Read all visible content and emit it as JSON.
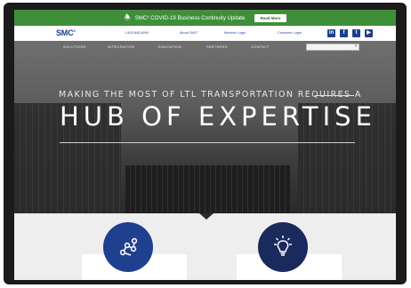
{
  "banner": {
    "text": "SMC³ COVID-19 Business Continuity Update",
    "button_label": "Read More",
    "icon": "bell-icon"
  },
  "topbar": {
    "logo": "SMC",
    "logo_sup": "3",
    "phone": "1-800-845-8090",
    "about": "About SMC³",
    "member_login": "Member Login",
    "customer_login": "Customer Login",
    "social": [
      {
        "icon": "linkedin-icon",
        "glyph": "in"
      },
      {
        "icon": "facebook-icon",
        "glyph": "f"
      },
      {
        "icon": "twitter-icon",
        "glyph": "t"
      },
      {
        "icon": "youtube-icon",
        "glyph": "▶"
      }
    ]
  },
  "nav": {
    "items": [
      "SOLUTIONS",
      "INTEGRATION",
      "EDUCATION",
      "PARTNERS",
      "CONTACT"
    ],
    "search_icon": "search-icon"
  },
  "hero": {
    "subhead": "MAKING THE MOST OF LTL TRANSPORTATION REQUIRES A",
    "headline": "HUB OF EXPERTISE"
  },
  "features": [
    {
      "icon": "network-nodes-icon"
    },
    {
      "icon": "lightbulb-icon"
    }
  ],
  "colors": {
    "banner_green": "#3f8f3a",
    "brand_blue": "#1d3f8c",
    "dark_frame": "#1b1b1b"
  }
}
